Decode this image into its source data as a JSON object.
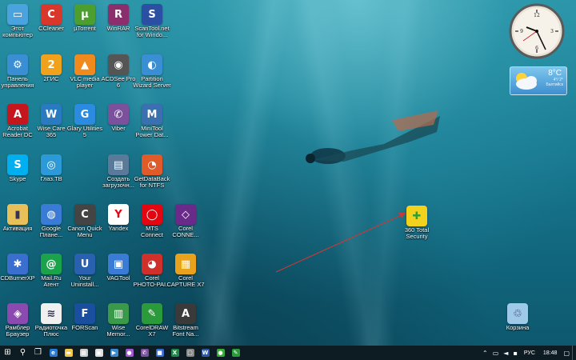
{
  "desktop": {
    "icons": [
      {
        "label": "Этот\nкомпьютер",
        "icon": "computer-icon",
        "color": "#4aa3df"
      },
      {
        "label": "CCleaner",
        "icon": "ccleaner-icon",
        "color": "#d9372b"
      },
      {
        "label": "µTorrent",
        "icon": "utorrent-icon",
        "color": "#4c9e2f"
      },
      {
        "label": "WinRAR",
        "icon": "winrar-icon",
        "color": "#8a2e6e"
      },
      {
        "label": "ScanTool.net\nfor Windo...",
        "icon": "scantool-icon",
        "color": "#2b4fa3"
      },
      {
        "label": "Панель\nуправления",
        "icon": "control-panel-icon",
        "color": "#3a8fd4"
      },
      {
        "label": "2ГИС",
        "icon": "2gis-icon",
        "color": "#f0a21c"
      },
      {
        "label": "VLC media\nplayer",
        "icon": "vlc-icon",
        "color": "#f08a1c"
      },
      {
        "label": "ACDSee Pro\n6",
        "icon": "acdsee-icon",
        "color": "#555555"
      },
      {
        "label": "Partition\nWizard Server",
        "icon": "partition-wizard-icon",
        "color": "#3a8fd4"
      },
      {
        "label": "Acrobat\nReader DC",
        "icon": "acrobat-icon",
        "color": "#c4161c"
      },
      {
        "label": "Wise Care\n365",
        "icon": "wise-care-icon",
        "color": "#2a7ac2"
      },
      {
        "label": "Glary Utilities\n5",
        "icon": "glary-icon",
        "color": "#2a8be0"
      },
      {
        "label": "Viber",
        "icon": "viber-icon",
        "color": "#7b519d"
      },
      {
        "label": "MiniTool\nPower Dat...",
        "icon": "minitool-icon",
        "color": "#3a6fb0"
      },
      {
        "label": "Skype",
        "icon": "skype-icon",
        "color": "#00aff0"
      },
      {
        "label": "Глаз.ТВ",
        "icon": "glaz-tv-icon",
        "color": "#2c9ad8"
      },
      {
        "label": "Создать\nзагрузочн...",
        "icon": "create-boot-icon",
        "color": "#5a7a9a"
      },
      {
        "label": "GetDataBack\nfor NTFS",
        "icon": "getdataback-icon",
        "color": "#e05a2a"
      },
      {
        "label": "Активация",
        "icon": "activation-icon",
        "color": "#e8c05a"
      },
      {
        "label": "Google\nПлане...",
        "icon": "google-earth-icon",
        "color": "#3a7bd5"
      },
      {
        "label": "Canon Quick\nMenu",
        "icon": "canon-icon",
        "color": "#444444"
      },
      {
        "label": "Yandex",
        "icon": "yandex-icon",
        "color": "#ffffff"
      },
      {
        "label": "MTS\nConnect",
        "icon": "mts-icon",
        "color": "#e30611"
      },
      {
        "label": "Corel\nCONNE...",
        "icon": "corel-connect-icon",
        "color": "#6a2a8a"
      },
      {
        "label": "CDBurnerXP",
        "icon": "cdburner-icon",
        "color": "#3a6fd0"
      },
      {
        "label": "Mail.Ru\nАгент",
        "icon": "mailru-icon",
        "color": "#1aa34a"
      },
      {
        "label": "Your\nUninstall...",
        "icon": "uninstaller-icon",
        "color": "#2a60b0"
      },
      {
        "label": "VAGTool",
        "icon": "vagtool-icon",
        "color": "#3a7bd5"
      },
      {
        "label": "Corel\nPHOTO-PAI...",
        "icon": "photopaint-icon",
        "color": "#d0302a"
      },
      {
        "label": "Corel\nCAPTURE X7",
        "icon": "corel-capture-icon",
        "color": "#e8a21c"
      },
      {
        "label": "Рамблер\nБраузер",
        "icon": "rambler-icon",
        "color": "#8a4ab0"
      },
      {
        "label": "Радиоточка\nПлюс",
        "icon": "radio-icon",
        "color": "#f0f0f0"
      },
      {
        "label": "FORScan",
        "icon": "forscan-icon",
        "color": "#1a4fa0"
      },
      {
        "label": "Wise\nMemor...",
        "icon": "wise-memory-icon",
        "color": "#3a9a4a"
      },
      {
        "label": "CorelDRAW\nX7",
        "icon": "coreldraw-icon",
        "color": "#2a9a3a"
      },
      {
        "label": "Bitstream\nFont Na...",
        "icon": "bitstream-icon",
        "color": "#3a3a3a"
      },
      {
        "label": "360 Total\nSecurity",
        "icon": "360-security-icon",
        "color": "#f2d21c"
      },
      {
        "label": "Корзина",
        "icon": "recycle-bin-icon",
        "color": "#9ec9e8"
      }
    ]
  },
  "gadgets": {
    "weather": {
      "temp": "8°C",
      "line1": "4°/ 2°",
      "line2": "Балтийск"
    }
  },
  "taskbar": {
    "apps": [
      {
        "icon": "start-icon",
        "color": "#ffffff"
      },
      {
        "icon": "search-icon",
        "color": "#ffffff"
      },
      {
        "icon": "task-view-icon",
        "color": "#ffffff"
      },
      {
        "icon": "edge-icon",
        "color": "#2a7ad5"
      },
      {
        "icon": "file-explorer-icon",
        "color": "#f2c84c"
      },
      {
        "icon": "calculator-icon",
        "color": "#cccccc"
      },
      {
        "icon": "store-icon",
        "color": "#dddddd"
      },
      {
        "icon": "media-icon",
        "color": "#3a8ad0"
      },
      {
        "icon": "app-icon-purple",
        "color": "#a05ad0"
      },
      {
        "icon": "viber-icon",
        "color": "#7b519d"
      },
      {
        "icon": "app-icon-blue",
        "color": "#3a6ad0"
      },
      {
        "icon": "excel-icon",
        "color": "#1f8a4a"
      },
      {
        "icon": "app-icon-grey",
        "color": "#888888"
      },
      {
        "icon": "word-icon",
        "color": "#2a5aa8"
      },
      {
        "icon": "app-icon-green",
        "color": "#3aaa3a"
      },
      {
        "icon": "coreldraw-icon",
        "color": "#2a9a3a"
      }
    ],
    "tray": {
      "language": "РУС",
      "time": "18:48"
    }
  }
}
